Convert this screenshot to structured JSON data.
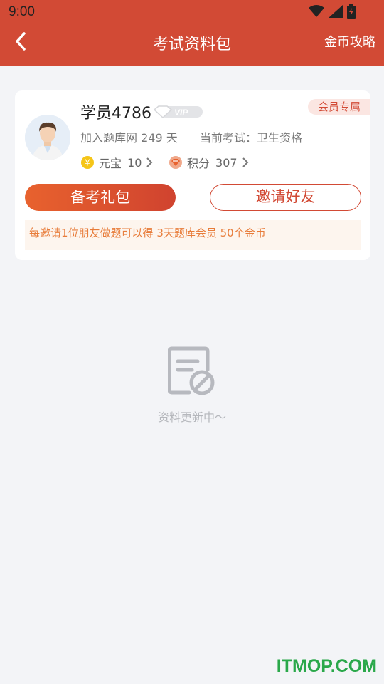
{
  "status_bar": {
    "time": "9:00"
  },
  "header": {
    "title": "考试资料包",
    "right_link": "金币攻略",
    "background": "#d24a35"
  },
  "profile": {
    "username": "学员4786",
    "vip_badge": "VIP",
    "member_tag": "会员专属",
    "join_info": "加入题库网 249 天",
    "exam_info": "当前考试：卫生资格",
    "yuanbao_label": "元宝",
    "yuanbao_value": "10",
    "jifen_label": "积分",
    "jifen_value": "307"
  },
  "actions": {
    "gift_label": "备考礼包",
    "invite_label": "邀请好友",
    "invite_note": "每邀请1位朋友做题可以得 3天题库会员 50个金币"
  },
  "empty_state": {
    "text": "资料更新中～",
    "icon": "document-ban-icon"
  },
  "watermark": "ITMOP.COM",
  "colors": {
    "accent": "#d24a35",
    "note_text": "#e87c3a",
    "background": "#f3f4f7"
  }
}
